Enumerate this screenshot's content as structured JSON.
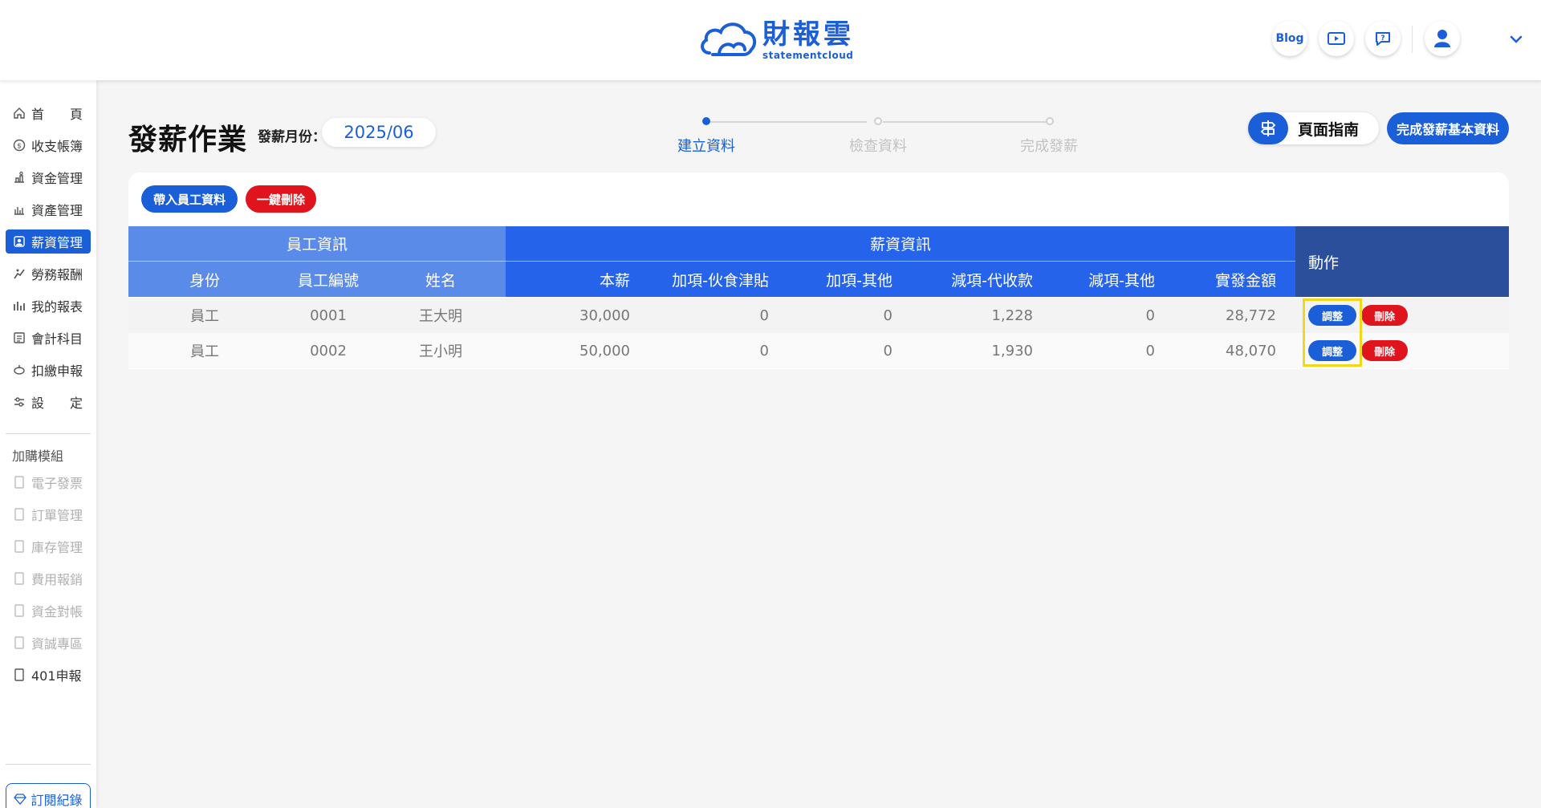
{
  "header": {
    "logo_main": "財報雲",
    "logo_sub": "statementcloud",
    "blog_label": "Blog"
  },
  "sidebar": {
    "items": [
      {
        "label": "首　　頁",
        "icon": "home-icon"
      },
      {
        "label": "收支帳簿",
        "icon": "ledger-icon"
      },
      {
        "label": "資金管理",
        "icon": "fund-icon"
      },
      {
        "label": "資產管理",
        "icon": "asset-icon"
      },
      {
        "label": "薪資管理",
        "icon": "payroll-icon"
      },
      {
        "label": "勞務報酬",
        "icon": "labor-icon"
      },
      {
        "label": "我的報表",
        "icon": "report-icon"
      },
      {
        "label": "會計科目",
        "icon": "account-icon"
      },
      {
        "label": "扣繳申報",
        "icon": "withholding-icon"
      },
      {
        "label": "設　　定",
        "icon": "settings-icon"
      }
    ],
    "addon_title": "加購模組",
    "addons": [
      {
        "label": "電子發票"
      },
      {
        "label": "訂單管理"
      },
      {
        "label": "庫存管理"
      },
      {
        "label": "費用報銷"
      },
      {
        "label": "資金對帳"
      },
      {
        "label": "資誠專區"
      },
      {
        "label": "401申報"
      }
    ],
    "subscription_label": "訂閱紀錄"
  },
  "page": {
    "title": "發薪作業",
    "month_label": "發薪月份：",
    "month_value": "2025/06",
    "guide_label": "頁面指南",
    "finish_label": "完成發薪基本資料",
    "steps": [
      "建立資料",
      "檢查資料",
      "完成發薪"
    ],
    "import_label": "帶入員工資料",
    "delete_all_label": "一鍵刪除"
  },
  "table": {
    "group_employee": "員工資訊",
    "group_salary": "薪資資訊",
    "group_action": "動作",
    "columns": [
      "身份",
      "員工編號",
      "姓名",
      "本薪",
      "加項-伙食津貼",
      "加項-其他",
      "減項-代收款",
      "減項-其他",
      "實發金額"
    ],
    "rows": [
      [
        "員工",
        "0001",
        "王大明",
        "30,000",
        "0",
        "0",
        "1,228",
        "0",
        "28,772"
      ],
      [
        "員工",
        "0002",
        "王小明",
        "50,000",
        "0",
        "0",
        "1,930",
        "0",
        "48,070"
      ]
    ],
    "adjust_label": "調整",
    "delete_label": "刪除"
  },
  "colors": {
    "primary": "#1b5fd8",
    "header_light": "#5b8be8",
    "header_dark": "#2c4f9c",
    "danger": "#e0141d",
    "highlight": "#f2d81a"
  }
}
